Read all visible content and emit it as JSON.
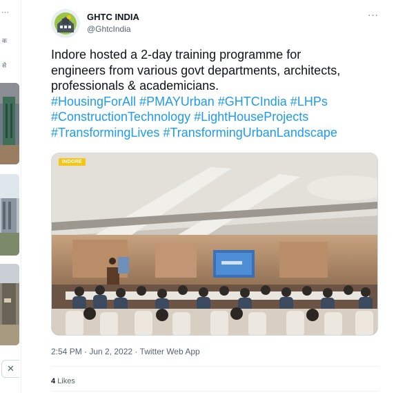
{
  "left_column": {
    "more_label": "···",
    "snippet_1": "क",
    "snippet_2": "से",
    "close_label": "✕"
  },
  "tweet": {
    "author_name": "GHTC INDIA",
    "author_handle": "@GhtcIndia",
    "more_label": "···",
    "text_lines": [
      "Indore hosted a 2-day training programme for",
      "engineers from various govt departments, architects,",
      "professionals & academicians."
    ],
    "hashtag_lines": [
      "#HousingForAll #PMAYUrban #GHTCIndia #LHPs",
      "#ConstructionTechnology #LightHouseProjects",
      "#TransformingLives #TransformingUrbanLandscape"
    ],
    "media_badge": "INDORE",
    "timestamp": "2:54 PM · Jun 2, 2022 · Twitter Web App",
    "likes_count": "4",
    "likes_label": "Likes"
  },
  "colors": {
    "link": "#1d9bf0",
    "text": "#0f1419",
    "muted": "#536471",
    "badge": "#f5c518"
  },
  "icons": [
    "avatar-house-icon",
    "more-icon",
    "close-icon"
  ]
}
